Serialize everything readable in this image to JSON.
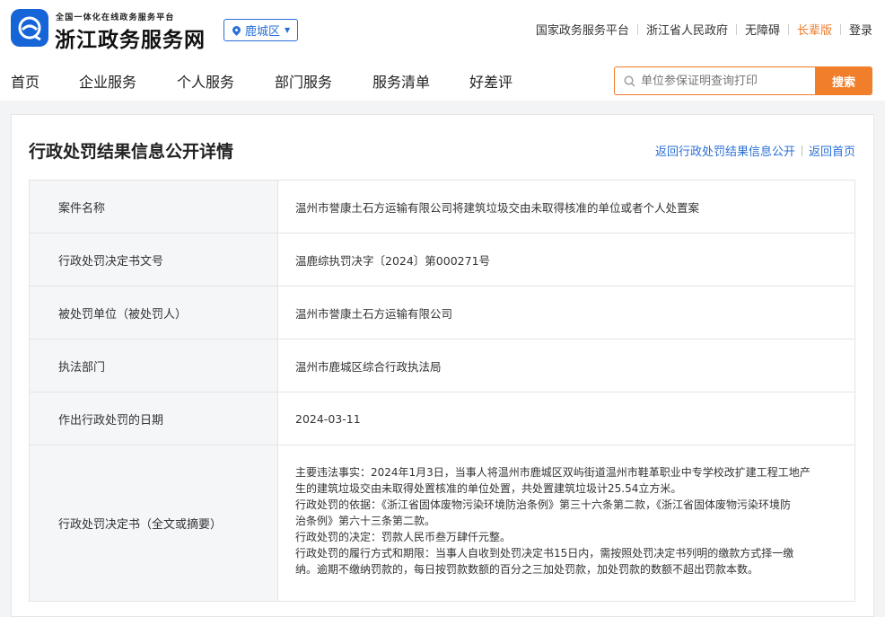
{
  "header": {
    "logo_small": "全国一体化在线政务服务平台",
    "logo_big": "浙江政务服务网",
    "region": "鹿城区",
    "top_links": [
      "国家政务服务平台",
      "浙江省人民政府",
      "无障碍",
      "长辈版",
      "登录"
    ]
  },
  "nav": {
    "items": [
      "首页",
      "企业服务",
      "个人服务",
      "部门服务",
      "服务清单",
      "好差评"
    ]
  },
  "search": {
    "placeholder": "单位参保证明查询打印",
    "button": "搜索"
  },
  "detail": {
    "title": "行政处罚结果信息公开详情",
    "back_list": "返回行政处罚结果信息公开",
    "back_home": "返回首页",
    "rows": [
      {
        "label": "案件名称",
        "value": "温州市誉康土石方运输有限公司将建筑垃圾交由未取得核准的单位或者个人处置案"
      },
      {
        "label": "行政处罚决定书文号",
        "value": "温鹿综执罚决字〔2024〕第000271号"
      },
      {
        "label": "被处罚单位（被处罚人）",
        "value": "温州市誉康土石方运输有限公司"
      },
      {
        "label": "执法部门",
        "value": "温州市鹿城区综合行政执法局"
      },
      {
        "label": "作出行政处罚的日期",
        "value": "2024-03-11"
      }
    ],
    "decision_label": "行政处罚决定书（全文或摘要）",
    "decision_lines": [
      "主要违法事实：2024年1月3日，当事人将温州市鹿城区双屿街道温州市鞋革职业中专学校改扩建工程工地产",
      "生的建筑垃圾交由未取得处置核准的单位处置，共处置建筑垃圾计25.54立方米。",
      "行政处罚的依据：《浙江省固体废物污染环境防治条例》第三十六条第二款，《浙江省固体废物污染环境防",
      "治条例》第六十三条第二款。",
      "行政处罚的决定：罚款人民币叁万肆仟元整。",
      "行政处罚的履行方式和期限：当事人自收到处罚决定书15日内，需按照处罚决定书列明的缴款方式择一缴",
      "纳。逾期不缴纳罚款的，每日按罚款数额的百分之三加处罚款，加处罚款的数额不超出罚款本数。"
    ]
  }
}
